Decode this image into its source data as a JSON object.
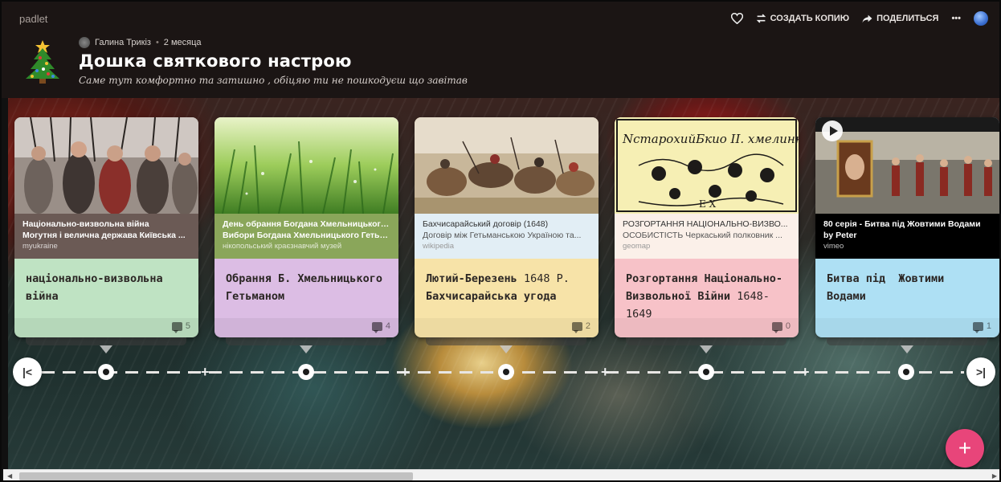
{
  "header": {
    "brand": "padlet",
    "author": "Галина Трикіз",
    "time": "2 месяца",
    "title": "Дошка святкового настрою",
    "subtitle": "Саме тут комфортно та затишно , обіцяю ти не пошкодуєш що завітав",
    "actions": {
      "like_icon": "heart-icon",
      "copy_label": "СОЗДАТЬ КОПИЮ",
      "share_label": "ПОДЕЛИТЬСЯ",
      "more_label": "•••"
    }
  },
  "cards": [
    {
      "preview_title": "Національно-визвольна війна",
      "preview_desc": "Могутня і велична держава Київська ...",
      "preview_source": "myukraine",
      "title": "національно-визвольна війна",
      "comments": "5",
      "color": "#bfe3c3",
      "preview_bg": "#6b5a55"
    },
    {
      "preview_title": "День обрання Богдана Хмельницького...",
      "preview_desc": "Вибори Богдана Хмельницького Гетьм...",
      "preview_source": "нікопольський краєзнавчий музей",
      "title": "Обрання Б. Хмельницького Гетьманом",
      "comments": "4",
      "color": "#dcbde4",
      "preview_bg": "#8aa65a"
    },
    {
      "preview_title": "Бахчисарайський договір (1648)",
      "preview_desc": "Договір між Гетьманською Україною та...",
      "preview_source": "wikipedia",
      "title_main": "Лютий-Березень",
      "title_thin": "1648 Р.",
      "title_rest": "Бахчисарайська угода",
      "comments": "2",
      "color": "#f7e3a8",
      "preview_bg": "#e2eef5"
    },
    {
      "preview_title": "РОЗГОРТАННЯ НАЦІОНАЛЬНО-ВИЗВО...",
      "preview_desc": "ОСОБИСТІСТЬ Черкаський полковник ...",
      "preview_source": "geomap",
      "title_main": "Розгортання Національно-Визвольної Війни",
      "title_thin": "1648-1649",
      "comments": "0",
      "color": "#f7c2c8",
      "preview_bg": "#fbf0e9"
    },
    {
      "preview_title": "80 серія - Битва під Жовтими Водами",
      "preview_desc": "by Peter",
      "preview_source": "vimeo",
      "title": "Битва під  Жовтими Водами",
      "comments": "1",
      "color": "#aee0f4",
      "preview_bg": "#000000"
    }
  ],
  "timeline": {
    "prev_label": "|<",
    "next_label": ">|",
    "add_symbol": "+"
  },
  "fab_label": "+"
}
